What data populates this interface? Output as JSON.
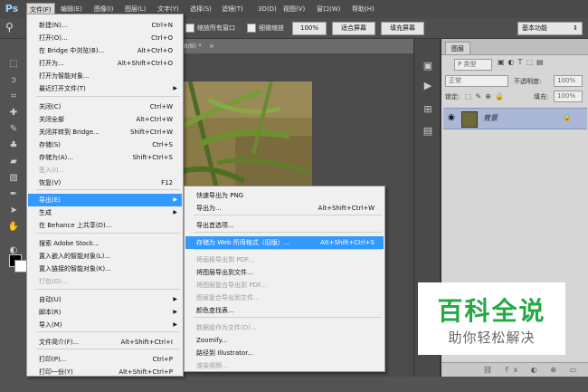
{
  "app": {
    "logo": "Ps"
  },
  "menubar": [
    "文件(F)",
    "编辑(E)",
    "图像(I)",
    "图层(L)",
    "文字(Y)",
    "选择(S)",
    "滤镜(T)",
    "3D(D)",
    "视图(V)",
    "窗口(W)",
    "帮助(H)"
  ],
  "options": {
    "fit_all_windows": "缩放所有窗口",
    "scrubby_zoom": "细微缩放",
    "zoom_pct": "100%",
    "fit_screen": "适合屏幕",
    "fill_screen": "填充屏幕",
    "workspace": "基本功能"
  },
  "document": {
    "tab_title": "8/8) *"
  },
  "file_menu": [
    {
      "label": "新建(N)...",
      "shortcut": "Ctrl+N"
    },
    {
      "label": "打开(O)...",
      "shortcut": "Ctrl+O"
    },
    {
      "label": "在 Bridge 中浏览(B)...",
      "shortcut": "Alt+Ctrl+O"
    },
    {
      "label": "打开为...",
      "shortcut": "Alt+Shift+Ctrl+O"
    },
    {
      "label": "打开为智能对象...",
      "shortcut": ""
    },
    {
      "label": "最近打开文件(T)",
      "shortcut": "",
      "submenu": true
    },
    {
      "label": "关闭(C)",
      "shortcut": "Ctrl+W"
    },
    {
      "label": "关闭全部",
      "shortcut": "Alt+Ctrl+W"
    },
    {
      "label": "关闭并转到 Bridge...",
      "shortcut": "Shift+Ctrl+W"
    },
    {
      "label": "存储(S)",
      "shortcut": "Ctrl+S"
    },
    {
      "label": "存储为(A)...",
      "shortcut": "Shift+Ctrl+S"
    },
    {
      "label": "签入(I)...",
      "shortcut": "",
      "disabled": true
    },
    {
      "label": "恢复(V)",
      "shortcut": "F12"
    },
    {
      "label": "导出(E)",
      "shortcut": "",
      "submenu": true,
      "highlight": true
    },
    {
      "label": "生成",
      "shortcut": "",
      "submenu": true
    },
    {
      "label": "在 Behance 上共享(D)...",
      "shortcut": ""
    },
    {
      "label": "搜索 Adobe Stock...",
      "shortcut": ""
    },
    {
      "label": "置入嵌入的智能对象(L)...",
      "shortcut": ""
    },
    {
      "label": "置入链接的智能对象(K)...",
      "shortcut": ""
    },
    {
      "label": "打包(G)...",
      "shortcut": "",
      "disabled": true
    },
    {
      "label": "自动(U)",
      "shortcut": "",
      "submenu": true
    },
    {
      "label": "脚本(R)",
      "shortcut": "",
      "submenu": true
    },
    {
      "label": "导入(M)",
      "shortcut": "",
      "submenu": true
    },
    {
      "label": "文件简介(F)...",
      "shortcut": "Alt+Shift+Ctrl+I"
    },
    {
      "label": "打印(P)...",
      "shortcut": "Ctrl+P"
    },
    {
      "label": "打印一份(Y)",
      "shortcut": "Alt+Shift+Ctrl+P"
    }
  ],
  "export_menu": [
    {
      "label": "快速导出为 PNG",
      "shortcut": ""
    },
    {
      "label": "导出为...",
      "shortcut": "Alt+Shift+Ctrl+W"
    },
    {
      "label": "导出首选项...",
      "shortcut": ""
    },
    {
      "label": "存储为 Web 所用格式（旧版）...",
      "shortcut": "Alt+Shift+Ctrl+S",
      "highlight": true
    },
    {
      "label": "将画板导出到 PDF...",
      "shortcut": "",
      "disabled": true
    },
    {
      "label": "将图层导出到文件...",
      "shortcut": ""
    },
    {
      "label": "将图层复合导出到 PDF...",
      "shortcut": "",
      "disabled": true
    },
    {
      "label": "图层复合导出到文件...",
      "shortcut": "",
      "disabled": true
    },
    {
      "label": "颜色查找表...",
      "shortcut": ""
    },
    {
      "label": "数据组作为文件(D)...",
      "shortcut": "",
      "disabled": true
    },
    {
      "label": "Zoomify...",
      "shortcut": ""
    },
    {
      "label": "路径到 Illustrator...",
      "shortcut": ""
    },
    {
      "label": "渲染视频...",
      "shortcut": "",
      "disabled": true
    }
  ],
  "layers": {
    "tab": "图层",
    "kind_label": "P 类型",
    "blend_mode": "正常",
    "opacity_label": "不透明度:",
    "opacity_value": "100%",
    "lock_label": "锁定:",
    "fill_label": "填充:",
    "fill_value": "100%",
    "layer_name": "背景"
  },
  "watermark": {
    "title": "百科全说",
    "subtitle": "助你轻松解决"
  }
}
